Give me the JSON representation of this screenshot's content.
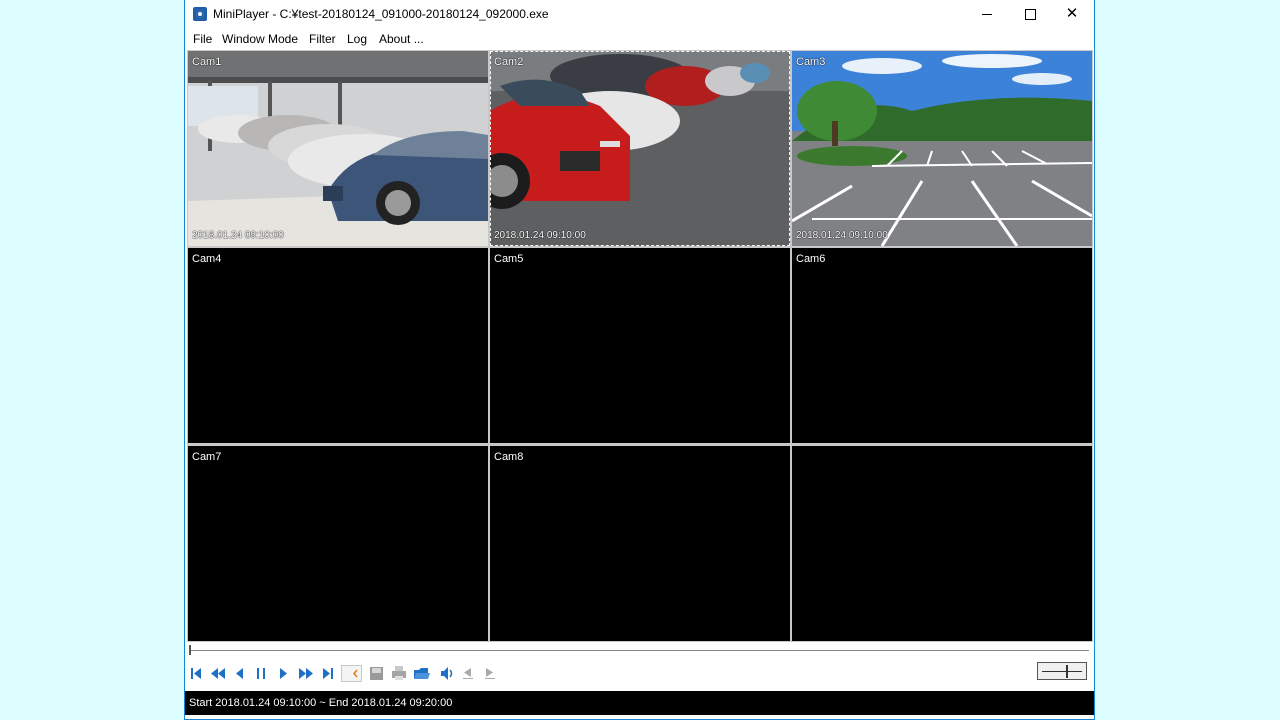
{
  "window": {
    "title": "MiniPlayer - C:¥test-20180124_091000-20180124_092000.exe",
    "app_icon": "camera-app-icon",
    "close_glyph": "✕"
  },
  "menu": [
    {
      "label": "File"
    },
    {
      "label": "Window Mode"
    },
    {
      "label": "Filter"
    },
    {
      "label": "Log"
    },
    {
      "label": "About ..."
    }
  ],
  "cameras": [
    {
      "label": "Cam1",
      "timestamp": "2018.01.24 09:10:00",
      "scene": "parking-garage-cars"
    },
    {
      "label": "Cam2",
      "timestamp": "2018.01.24 09:10:00",
      "scene": "parked-red-car",
      "selected": true
    },
    {
      "label": "Cam3",
      "timestamp": "2018.01.24 09:10:00",
      "scene": "empty-parking-lot"
    },
    {
      "label": "Cam4",
      "timestamp": ""
    },
    {
      "label": "Cam5",
      "timestamp": ""
    },
    {
      "label": "Cam6",
      "timestamp": ""
    },
    {
      "label": "Cam7",
      "timestamp": ""
    },
    {
      "label": "Cam8",
      "timestamp": ""
    },
    {
      "label": "",
      "timestamp": ""
    }
  ],
  "controls": {
    "icons": [
      "skip-to-start-icon",
      "rewind-icon",
      "step-back-icon",
      "pause-icon",
      "play-icon",
      "fast-forward-icon",
      "skip-to-end-icon",
      "mark-icon",
      "save-icon",
      "print-icon",
      "open-folder-icon",
      "volume-icon",
      "prev-frame-icon",
      "next-frame-icon"
    ],
    "accent": "#1f6fc5"
  },
  "seek_progress": 0.0,
  "zoom_level": 0.6,
  "status": {
    "text": "Start  2018.01.24  09:10:00 ~ End  2018.01.24  09:20:00"
  }
}
